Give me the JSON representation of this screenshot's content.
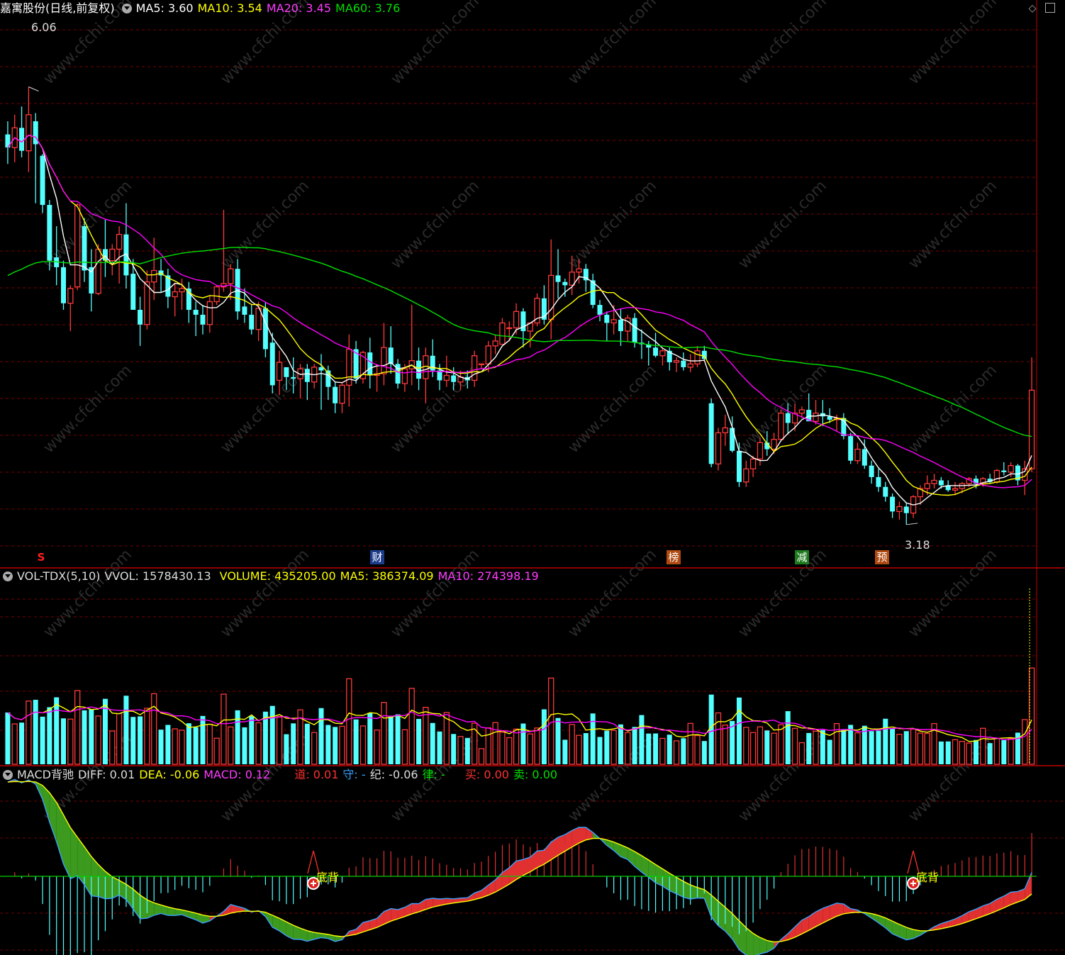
{
  "header_main": {
    "stock": "嘉寓股份(日线,前复权)",
    "ma5": "MA5: 3.60",
    "ma10": "MA10: 3.54",
    "ma20": "MA20: 3.45",
    "ma60": "MA60: 3.76"
  },
  "header_vol": {
    "name": "VOL-TDX(5,10)",
    "vvol": "VVOL: 1578430.13",
    "volume": "VOLUME: 435205.00",
    "ma5": "MA5: 386374.09",
    "ma10": "MA10: 274398.19"
  },
  "header_macd": {
    "name": "MACD背驰",
    "diff": "DIFF: 0.01",
    "dea": "DEA: -0.06",
    "macd": "MACD: 0.12",
    "dao": "道: 0.01",
    "shou": "守: -",
    "ji": "纪: -0.06",
    "lv": "律: -",
    "mai": "买: 0.00",
    "sell": "卖: 0.00"
  },
  "markers": {
    "high": "6.06",
    "low": "3.18",
    "s": "S",
    "cai": "财",
    "bang": "榜",
    "jian": "减",
    "yu": "预",
    "dibei": "底背"
  },
  "watermark": "www.cfchi.com",
  "colors": {
    "up": "#ff3a3a",
    "down": "#54ffff",
    "ma5": "#ffffff",
    "ma10": "#ffff00",
    "ma20": "#ff00ff",
    "ma60": "#00e000",
    "grid": "#7a0000"
  },
  "chart_data": {
    "type": "candlestick",
    "price_range": [
      3.05,
      6.25
    ],
    "high_mark": 6.06,
    "low_mark": 3.18,
    "candles": [
      [
        5.56,
        5.64,
        5.38,
        5.48
      ],
      [
        5.48,
        5.68,
        5.39,
        5.6
      ],
      [
        5.6,
        5.73,
        5.42,
        5.46
      ],
      [
        5.46,
        5.85,
        5.33,
        5.68
      ],
      [
        5.64,
        5.69,
        5.14,
        5.5
      ],
      [
        5.43,
        5.44,
        5.08,
        5.13
      ],
      [
        5.13,
        5.16,
        4.73,
        4.79
      ],
      [
        4.81,
        5.0,
        4.64,
        4.75
      ],
      [
        4.75,
        4.79,
        4.49,
        4.53
      ],
      [
        4.53,
        4.64,
        4.36,
        4.62
      ],
      [
        4.63,
        5.14,
        4.61,
        5.13
      ],
      [
        5.0,
        5.05,
        4.66,
        4.73
      ],
      [
        4.75,
        4.86,
        4.48,
        4.59
      ],
      [
        4.59,
        4.89,
        4.58,
        4.86
      ],
      [
        4.86,
        5.04,
        4.69,
        4.79
      ],
      [
        4.79,
        4.89,
        4.7,
        4.86
      ],
      [
        4.86,
        5.0,
        4.65,
        4.95
      ],
      [
        4.95,
        5.14,
        4.62,
        4.7
      ],
      [
        4.71,
        4.8,
        4.49,
        4.49
      ],
      [
        4.49,
        4.57,
        4.27,
        4.4
      ],
      [
        4.4,
        4.73,
        4.37,
        4.66
      ],
      [
        4.66,
        4.93,
        4.55,
        4.73
      ],
      [
        4.73,
        4.8,
        4.6,
        4.7
      ],
      [
        4.7,
        4.74,
        4.5,
        4.57
      ],
      [
        4.57,
        4.65,
        4.45,
        4.6
      ],
      [
        4.6,
        4.68,
        4.49,
        4.62
      ],
      [
        4.62,
        4.66,
        4.41,
        4.49
      ],
      [
        4.49,
        4.54,
        4.33,
        4.46
      ],
      [
        4.46,
        4.52,
        4.34,
        4.4
      ],
      [
        4.4,
        4.58,
        4.35,
        4.54
      ],
      [
        4.54,
        4.64,
        4.52,
        4.63
      ],
      [
        4.63,
        5.1,
        4.6,
        4.65
      ],
      [
        4.65,
        4.77,
        4.55,
        4.74
      ],
      [
        4.74,
        4.8,
        4.43,
        4.48
      ],
      [
        4.51,
        4.62,
        4.41,
        4.46
      ],
      [
        4.46,
        4.52,
        4.34,
        4.37
      ],
      [
        4.37,
        4.54,
        4.3,
        4.5
      ],
      [
        4.5,
        4.54,
        4.2,
        4.25
      ],
      [
        4.29,
        4.35,
        3.98,
        4.03
      ],
      [
        4.06,
        4.24,
        3.97,
        4.17
      ],
      [
        4.14,
        4.14,
        4.0,
        4.08
      ],
      [
        4.08,
        4.2,
        3.98,
        4.07
      ],
      [
        4.07,
        4.16,
        3.95,
        4.13
      ],
      [
        4.13,
        4.16,
        3.94,
        4.05
      ],
      [
        4.05,
        4.16,
        4.01,
        4.14
      ],
      [
        4.14,
        4.22,
        3.88,
        4.12
      ],
      [
        4.12,
        4.15,
        3.94,
        4.02
      ],
      [
        4.02,
        4.05,
        3.86,
        3.92
      ],
      [
        3.92,
        4.05,
        3.86,
        4.03
      ],
      [
        4.03,
        4.34,
        3.9,
        4.25
      ],
      [
        4.25,
        4.3,
        4.04,
        4.07
      ],
      [
        4.07,
        4.24,
        4.04,
        4.23
      ],
      [
        4.23,
        4.32,
        4.01,
        4.09
      ],
      [
        4.09,
        4.16,
        3.99,
        4.1
      ],
      [
        4.1,
        4.41,
        4.03,
        4.26
      ],
      [
        4.26,
        4.39,
        4.1,
        4.16
      ],
      [
        4.16,
        4.19,
        4.01,
        4.04
      ],
      [
        4.04,
        4.16,
        3.99,
        4.13
      ],
      [
        4.13,
        4.52,
        4.03,
        4.18
      ],
      [
        4.18,
        4.26,
        4.0,
        4.07
      ],
      [
        4.07,
        4.26,
        3.92,
        4.21
      ],
      [
        4.21,
        4.31,
        4.08,
        4.12
      ],
      [
        4.12,
        4.16,
        4.0,
        4.06
      ],
      [
        4.06,
        4.21,
        4.02,
        4.09
      ],
      [
        4.09,
        4.14,
        4.0,
        4.05
      ],
      [
        4.05,
        4.12,
        4.0,
        4.08
      ],
      [
        4.08,
        4.12,
        4.01,
        4.06
      ],
      [
        4.06,
        4.24,
        4.02,
        4.21
      ],
      [
        4.16,
        4.16,
        4.13,
        4.16
      ],
      [
        4.16,
        4.3,
        4.11,
        4.27
      ],
      [
        4.27,
        4.34,
        4.22,
        4.3
      ],
      [
        4.28,
        4.44,
        4.28,
        4.41
      ],
      [
        4.38,
        4.42,
        4.3,
        4.38
      ],
      [
        4.38,
        4.53,
        4.34,
        4.48
      ],
      [
        4.48,
        4.5,
        4.26,
        4.36
      ],
      [
        4.36,
        4.41,
        4.26,
        4.41
      ],
      [
        4.41,
        4.59,
        4.39,
        4.56
      ],
      [
        4.56,
        4.64,
        4.4,
        4.43
      ],
      [
        4.43,
        4.92,
        4.31,
        4.7
      ],
      [
        4.7,
        4.86,
        4.56,
        4.66
      ],
      [
        4.66,
        4.68,
        4.57,
        4.64
      ],
      [
        4.64,
        4.82,
        4.58,
        4.72
      ],
      [
        4.72,
        4.8,
        4.65,
        4.74
      ],
      [
        4.74,
        4.77,
        4.6,
        4.67
      ],
      [
        4.67,
        4.71,
        4.5,
        4.52
      ],
      [
        4.52,
        4.55,
        4.42,
        4.46
      ],
      [
        4.46,
        4.48,
        4.3,
        4.41
      ],
      [
        4.41,
        4.52,
        4.34,
        4.43
      ],
      [
        4.43,
        4.5,
        4.27,
        4.36
      ],
      [
        4.36,
        4.46,
        4.3,
        4.44
      ],
      [
        4.44,
        4.47,
        4.26,
        4.29
      ],
      [
        4.29,
        4.37,
        4.19,
        4.28
      ],
      [
        4.28,
        4.3,
        4.15,
        4.26
      ],
      [
        4.26,
        4.35,
        4.2,
        4.21
      ],
      [
        4.21,
        4.26,
        4.15,
        4.24
      ],
      [
        4.24,
        4.26,
        4.12,
        4.17
      ],
      [
        4.17,
        4.2,
        4.11,
        4.18
      ],
      [
        4.18,
        4.23,
        4.12,
        4.14
      ],
      [
        4.14,
        4.22,
        4.11,
        4.16
      ],
      [
        4.16,
        4.27,
        4.14,
        4.24
      ],
      [
        4.24,
        4.27,
        4.18,
        4.19
      ],
      [
        3.92,
        3.95,
        3.53,
        3.55
      ],
      [
        3.55,
        3.77,
        3.51,
        3.74
      ],
      [
        3.74,
        3.85,
        3.66,
        3.77
      ],
      [
        3.77,
        3.84,
        3.62,
        3.63
      ],
      [
        3.63,
        3.68,
        3.41,
        3.44
      ],
      [
        3.44,
        3.57,
        3.41,
        3.52
      ],
      [
        3.52,
        3.6,
        3.47,
        3.58
      ],
      [
        3.58,
        3.71,
        3.54,
        3.68
      ],
      [
        3.68,
        3.75,
        3.6,
        3.64
      ],
      [
        3.64,
        3.74,
        3.61,
        3.7
      ],
      [
        3.7,
        3.88,
        3.69,
        3.86
      ],
      [
        3.86,
        3.92,
        3.73,
        3.8
      ],
      [
        3.8,
        3.92,
        3.75,
        3.86
      ],
      [
        3.86,
        3.9,
        3.83,
        3.88
      ],
      [
        3.88,
        3.98,
        3.84,
        3.81
      ],
      [
        3.81,
        3.94,
        3.79,
        3.86
      ],
      [
        3.86,
        3.94,
        3.78,
        3.84
      ],
      [
        3.84,
        3.89,
        3.8,
        3.82
      ],
      [
        3.82,
        3.85,
        3.75,
        3.83
      ],
      [
        3.83,
        3.86,
        3.7,
        3.72
      ],
      [
        3.72,
        3.74,
        3.55,
        3.57
      ],
      [
        3.57,
        3.68,
        3.55,
        3.64
      ],
      [
        3.64,
        3.7,
        3.52,
        3.54
      ],
      [
        3.54,
        3.57,
        3.43,
        3.47
      ],
      [
        3.47,
        3.52,
        3.38,
        3.41
      ],
      [
        3.41,
        3.44,
        3.32,
        3.35
      ],
      [
        3.35,
        3.37,
        3.22,
        3.26
      ],
      [
        3.26,
        3.32,
        3.21,
        3.29
      ],
      [
        3.29,
        3.31,
        3.18,
        3.25
      ],
      [
        3.25,
        3.36,
        3.22,
        3.35
      ],
      [
        3.35,
        3.42,
        3.3,
        3.4
      ],
      [
        3.4,
        3.48,
        3.36,
        3.43
      ],
      [
        3.43,
        3.49,
        3.4,
        3.45
      ],
      [
        3.45,
        3.47,
        3.4,
        3.42
      ],
      [
        3.42,
        3.45,
        3.38,
        3.39
      ],
      [
        3.39,
        3.44,
        3.36,
        3.4
      ],
      [
        3.4,
        3.44,
        3.37,
        3.43
      ],
      [
        3.43,
        3.47,
        3.41,
        3.46
      ],
      [
        3.46,
        3.48,
        3.4,
        3.43
      ],
      [
        3.43,
        3.47,
        3.41,
        3.46
      ],
      [
        3.46,
        3.49,
        3.43,
        3.44
      ],
      [
        3.44,
        3.52,
        3.43,
        3.51
      ],
      [
        3.51,
        3.56,
        3.48,
        3.5
      ],
      [
        3.5,
        3.56,
        3.47,
        3.54
      ],
      [
        3.54,
        3.55,
        3.42,
        3.45
      ],
      [
        3.45,
        3.57,
        3.36,
        3.52
      ],
      [
        3.52,
        4.2,
        3.5,
        4.0
      ]
    ]
  }
}
